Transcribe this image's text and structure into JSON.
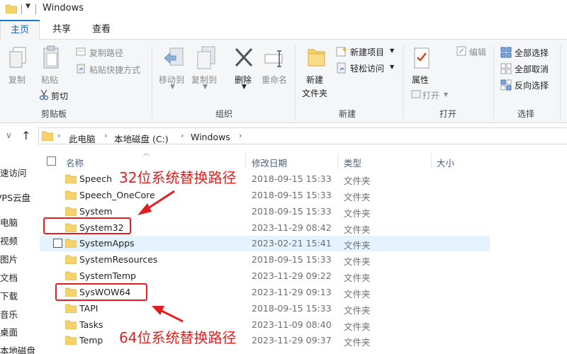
{
  "window": {
    "title": "Windows"
  },
  "tabs": [
    {
      "label": "主页"
    },
    {
      "label": "共享"
    },
    {
      "label": "查看"
    }
  ],
  "ribbon": {
    "clipboard": {
      "copy": "复制",
      "paste": "粘贴",
      "copy_path": "复制路径",
      "paste_shortcut": "粘贴快捷方式",
      "cut": "剪切",
      "group": "剪贴板"
    },
    "organize": {
      "move_to": "移动到",
      "copy_to": "复制到",
      "delete": "删除",
      "rename": "重命名",
      "group": "组织"
    },
    "new": {
      "new_folder_1": "新建",
      "new_folder_2": "文件夹",
      "new_item": "新建项目",
      "easy_access": "轻松访问",
      "group": "新建"
    },
    "open": {
      "properties": "属性",
      "open": "打开",
      "edit": "编辑",
      "group": "打开"
    },
    "select": {
      "select_all": "全部选择",
      "select_none": "全部取消",
      "invert": "反向选择",
      "group": "选择"
    }
  },
  "address": {
    "crumbs": [
      "此电脑",
      "本地磁盘 (C:)",
      "Windows"
    ]
  },
  "nav": [
    "速访问",
    "VPS云盘",
    "电脑",
    "视频",
    "图片",
    "文档",
    "下载",
    "音乐",
    "桌面",
    "本地磁盘"
  ],
  "columns": {
    "name": "名称",
    "date": "修改日期",
    "type": "类型",
    "size": "大小"
  },
  "files": [
    {
      "name": "Speech",
      "date": "2018-09-15 15:33",
      "type": "文件夹"
    },
    {
      "name": "Speech_OneCore",
      "date": "2018-09-15 15:33",
      "type": "文件夹"
    },
    {
      "name": "System",
      "date": "2018-09-15 15:33",
      "type": "文件夹"
    },
    {
      "name": "System32",
      "date": "2023-11-29 08:42",
      "type": "文件夹"
    },
    {
      "name": "SystemApps",
      "date": "2023-02-21 15:41",
      "type": "文件夹"
    },
    {
      "name": "SystemResources",
      "date": "2018-09-15 15:33",
      "type": "文件夹"
    },
    {
      "name": "SystemTemp",
      "date": "2023-11-29 09:22",
      "type": "文件夹"
    },
    {
      "name": "SysWOW64",
      "date": "2023-11-29 09:13",
      "type": "文件夹"
    },
    {
      "name": "TAPI",
      "date": "2018-09-15 15:33",
      "type": "文件夹"
    },
    {
      "name": "Tasks",
      "date": "2023-11-09 08:40",
      "type": "文件夹"
    },
    {
      "name": "Temp",
      "date": "2023-11-29 09:37",
      "type": "文件夹"
    }
  ],
  "annotations": {
    "top": "32位系统替换路径",
    "bottom": "64位系统替换路径",
    "color": "#e02020"
  },
  "colors": {
    "accent": "#1979ca",
    "folder": "#f6d26b",
    "hover": "#e5f3ff"
  }
}
